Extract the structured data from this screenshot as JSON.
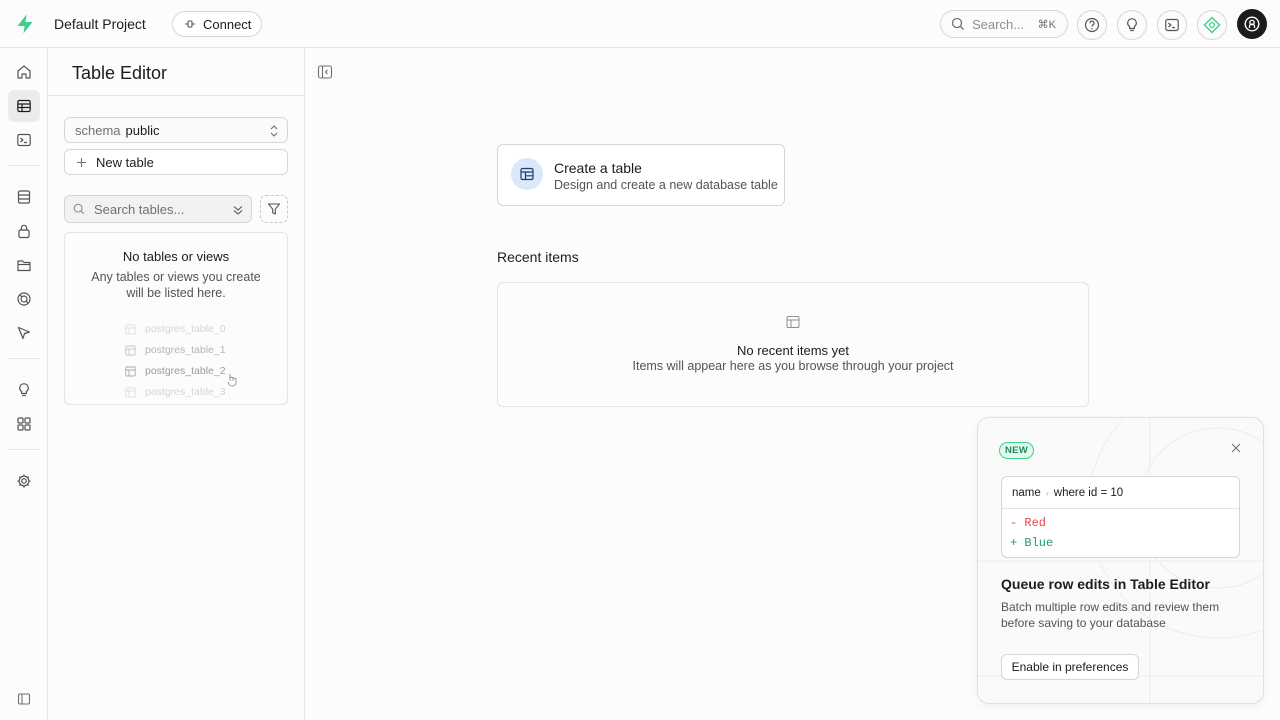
{
  "header": {
    "project_name": "Default Project",
    "connect_label": "Connect",
    "search_placeholder": "Search...",
    "search_shortcut": "⌘K",
    "icons": [
      "help-icon",
      "lightbulb-icon",
      "terminal-icon",
      "assistant-icon",
      "avatar"
    ]
  },
  "sidebar_nav": {
    "items": [
      "home-icon",
      "table-editor-icon",
      "sql-editor-icon",
      "database-icon",
      "auth-icon",
      "storage-icon",
      "realtime-icon",
      "edge-functions-icon",
      "advisors-icon",
      "integrations-icon",
      "settings-icon"
    ],
    "active": "table-editor-icon"
  },
  "panel": {
    "title": "Table Editor",
    "schema_label": "schema",
    "schema_value": "public",
    "new_table_label": "New table",
    "search_placeholder": "Search tables...",
    "empty_title": "No tables or views",
    "empty_desc": "Any tables or views you create will be listed here.",
    "ghost_tables": [
      "postgres_table_0",
      "postgres_table_1",
      "postgres_table_2",
      "postgres_table_3"
    ]
  },
  "main": {
    "create_title": "Create a table",
    "create_sub": "Design and create a new database table",
    "recent_heading": "Recent items",
    "recent_empty_title": "No recent items yet",
    "recent_empty_sub": "Items will appear here as you browse through your project"
  },
  "promo": {
    "badge": "NEW",
    "diff_column": "name",
    "diff_where": "where id = 10",
    "diff_removed": "- Red",
    "diff_added": "+ Blue",
    "title": "Queue row edits in Table Editor",
    "desc": "Batch multiple row edits and review them before saving to your database",
    "button": "Enable in preferences"
  },
  "colors": {
    "brand": "#3ecf8e",
    "removed": "#e5484d",
    "added": "#1e9e64"
  }
}
